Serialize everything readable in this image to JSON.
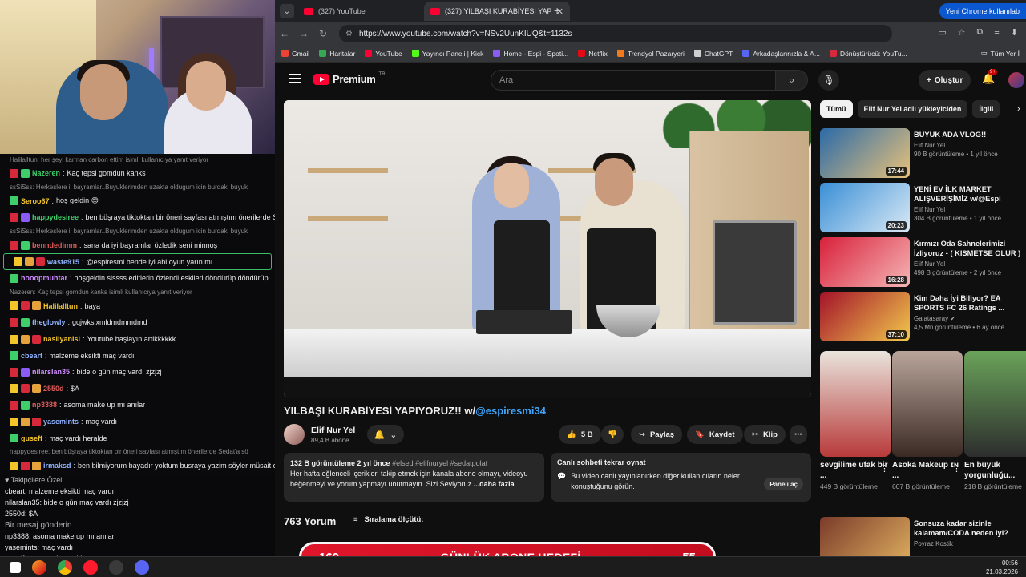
{
  "chat": {
    "lines": [
      {
        "type": "sys",
        "text": "Halilalltun: her şeyi karman carbon ettim isimli kullanıcıya yanıt veriyor"
      },
      {
        "type": "msg",
        "user": "Nazeren",
        "color": "#3fcf6a",
        "text": "Kaç tepsi gomdun kanks"
      },
      {
        "type": "sys",
        "text": "ssSiSss: Herkeslere ii bayramlar..Buyuklerimden uzakta oldugum icin burdaki buyuk"
      },
      {
        "type": "msg",
        "user": "Seroo67",
        "color": "#f2c52b",
        "text": "hoş geldin 😊"
      },
      {
        "type": "msg",
        "user": "happydesiree",
        "color": "#3fcf6a",
        "text": "ben büşraya tiktoktan bir öneri sayfası atmıştım önerilerde Sec"
      },
      {
        "type": "sys",
        "text": "ssSiSss: Herkeslere ii bayramlar..Buyuklerimden uzakta oldugum icin burdaki buyuk"
      },
      {
        "type": "msg",
        "user": "benndedimm",
        "color": "#e05a5a",
        "text": "sana da iyi bayramlar özledik seni minnoş"
      },
      {
        "type": "hl",
        "user": "waste915",
        "color": "#8fb4ff",
        "text": "@espiresmi bende iyi abi oyun yarın mı"
      },
      {
        "type": "msg",
        "user": "hooopmuhtar",
        "color": "#d08cff",
        "text": "hoşgeldin sissss editlerin özlendi eskileri döndürüp döndürüp"
      },
      {
        "type": "sys",
        "text": "Nazeren: Kaç tepsi gomdun kanks isimli kullanıcıya yanıt veriyor"
      },
      {
        "type": "msg",
        "user": "Halilalltun",
        "color": "#f2c52b",
        "text": "baya"
      },
      {
        "type": "msg",
        "user": "theglowly",
        "color": "#8fb4ff",
        "text": "gqjwkslxmldmdmmdmd"
      },
      {
        "type": "msg",
        "user": "nasilyanisi",
        "color": "#f2c52b",
        "text": "Youtube başlayın artikkkkkk"
      },
      {
        "type": "msg",
        "user": "cbeart",
        "color": "#8fb4ff",
        "text": "malzeme eksikti maç vardı"
      },
      {
        "type": "msg",
        "user": "nilarslan35",
        "color": "#d08cff",
        "text": "bide o gün maç vardı zjzjzj"
      },
      {
        "type": "msg",
        "user": "2550d",
        "color": "#e05a5a",
        "text": "$A"
      },
      {
        "type": "msg",
        "user": "np3388",
        "color": "#e05a5a",
        "text": "asoma make up mı anılar"
      },
      {
        "type": "msg",
        "user": "yasemints",
        "color": "#8fb4ff",
        "text": "maç vardı"
      },
      {
        "type": "msg",
        "user": "guseff",
        "color": "#f2c52b",
        "text": "maç vardı heralde"
      },
      {
        "type": "sys",
        "text": "happydesiree: ben büşraya tiktoktan bir öneri sayfası atmıştım önerilerde Sedat'a sö"
      },
      {
        "type": "msg",
        "user": "irmaksd",
        "color": "#8fb4ff",
        "text": "ben bilmiyorum bayadır yoktum busraya yazim söyler müsait olu"
      }
    ],
    "bottom_lines": [
      "♥ Takipçilere Özel",
      "cbeart: malzeme eksikti maç vardı",
      "nilarslan35: bide o gün maç vardı zjzjzj",
      "2550d: $A",
      "Bir mesaj gönderin",
      "np3388: asoma make up mı anılar",
      "yasemints: maç vardı",
      "guseff: maç vardı heralde"
    ]
  },
  "browser": {
    "tabs": [
      {
        "title": "(327) YouTube",
        "active": false
      },
      {
        "title": "(327) YILBAŞI KURABİYESİ YAPIYORUZ",
        "active": true
      }
    ],
    "signin": "Yeni Chrome kullanılab",
    "url": "https://www.youtube.com/watch?v=NSv2UunKIUQ&t=1132s",
    "bookmarks": [
      {
        "label": "Gmail",
        "color": "#ea4335"
      },
      {
        "label": "Haritalar",
        "color": "#34a853"
      },
      {
        "label": "YouTube",
        "color": "#ff0033"
      },
      {
        "label": "Yayıncı Paneli | Kick",
        "color": "#53fc18"
      },
      {
        "label": "Home - Espi - Spoti...",
        "color": "#8a5cf6"
      },
      {
        "label": "Netflix",
        "color": "#e50914"
      },
      {
        "label": "Trendyol Pazaryeri",
        "color": "#f27a1a"
      },
      {
        "label": "ChatGPT",
        "color": "#cfcfcf"
      },
      {
        "label": "Arkadaşlarınızla & A...",
        "color": "#5865f2"
      },
      {
        "label": "Dönüştürücü: YouTu...",
        "color": "#d6293c"
      }
    ],
    "bookmarks_all": "Tüm Yer İ"
  },
  "youtube": {
    "logo": "Premium",
    "logo_sup": "TR",
    "search_placeholder": "Ara",
    "create_label": "Oluştur",
    "notif_count": "9+",
    "video": {
      "title": "YILBAŞI KURABİYESİ YAPIYORUZ!! w/",
      "title_tag": "@espiresmi34",
      "channel": "Elif Nur Yel",
      "subs": "89,4 B abone",
      "likes": "5 B",
      "share": "Paylaş",
      "save": "Kaydet",
      "clip": "Klip",
      "desc_meta": "132 B görüntüleme  2 yıl önce",
      "desc_tags": "#elsed #elifnuryel #sedatpolat",
      "desc_text": "Her hafta eğlenceli içerikleri takip etmek için kanala abone olmayı, videoyu beğenmeyi ve yorum yapmayı unutmayın. Sizi Seviyoruz",
      "desc_more": "...daha fazla",
      "live_title": "Canlı sohbeti tekrar oynat",
      "live_text": "Bu video canlı yayınlanırken diğer kullanıcıların neler konuştuğunu görün.",
      "live_btn": "Paneli aç",
      "comments": "763 Yorum",
      "sort": "Sıralama ölçütü:"
    },
    "chips": [
      "Tümü",
      "Elif Nur Yel adlı yükleyiciden",
      "İlgili"
    ],
    "recs": [
      {
        "title": "BÜYÜK ADA VLOG!!",
        "channel": "Elif Nur Yel",
        "meta": "90 B görüntüleme • 1 yıl önce",
        "dur": "17:44",
        "c1": "#2b6aa8",
        "c2": "#e8c27a"
      },
      {
        "title": "YENİ EV İLK MARKET ALIŞVERİŞİMİZ w/@Espi",
        "channel": "Elif Nur Yel",
        "meta": "304 B görüntüleme • 1 yıl önce",
        "dur": "20:23",
        "c1": "#3a8fd6",
        "c2": "#d9e9f5"
      },
      {
        "title": "Kırmızı Oda Sahnelerimizi İzliyoruz - ( KISMETSE OLUR )",
        "channel": "Elif Nur Yel",
        "meta": "498 B görüntüleme • 2 yıl önce",
        "dur": "16:28",
        "c1": "#d8203a",
        "c2": "#f5b5b5"
      },
      {
        "title": "Kim Daha İyi Biliyor? EA SPORTS FC 26 Ratings ...",
        "channel": "Galatasaray ✔",
        "meta": "4,5 Mn görüntüleme • 6 ay önce",
        "dur": "37:10",
        "c1": "#a3122a",
        "c2": "#f2c94c"
      }
    ],
    "shorts": [
      {
        "title": "sevgilime ufak bir ...",
        "views": "449 B görüntüleme",
        "c1": "#e9e4dc",
        "c2": "#b83a3a"
      },
      {
        "title": "Asoka Makeup ɪɴ ...",
        "views": "607 B görüntüleme",
        "c1": "#b9a59a",
        "c2": "#3b2a24"
      },
      {
        "title": "En büyük yorgunluğu...",
        "views": "218 B görüntüleme",
        "c1": "#6aa35a",
        "c2": "#2d2d2d"
      }
    ],
    "next_rec": {
      "title": "Sonsuza kadar sizinle kalamam/CODA neden iyi?",
      "channel": "Poyraz Kostik",
      "meta": "..."
    }
  },
  "goal": {
    "left": "160",
    "label": "GÜNLÜK ABONE HEDEFİ",
    "right": "55"
  },
  "taskbar": {
    "time": "00:56",
    "date": "21.03.2026"
  }
}
